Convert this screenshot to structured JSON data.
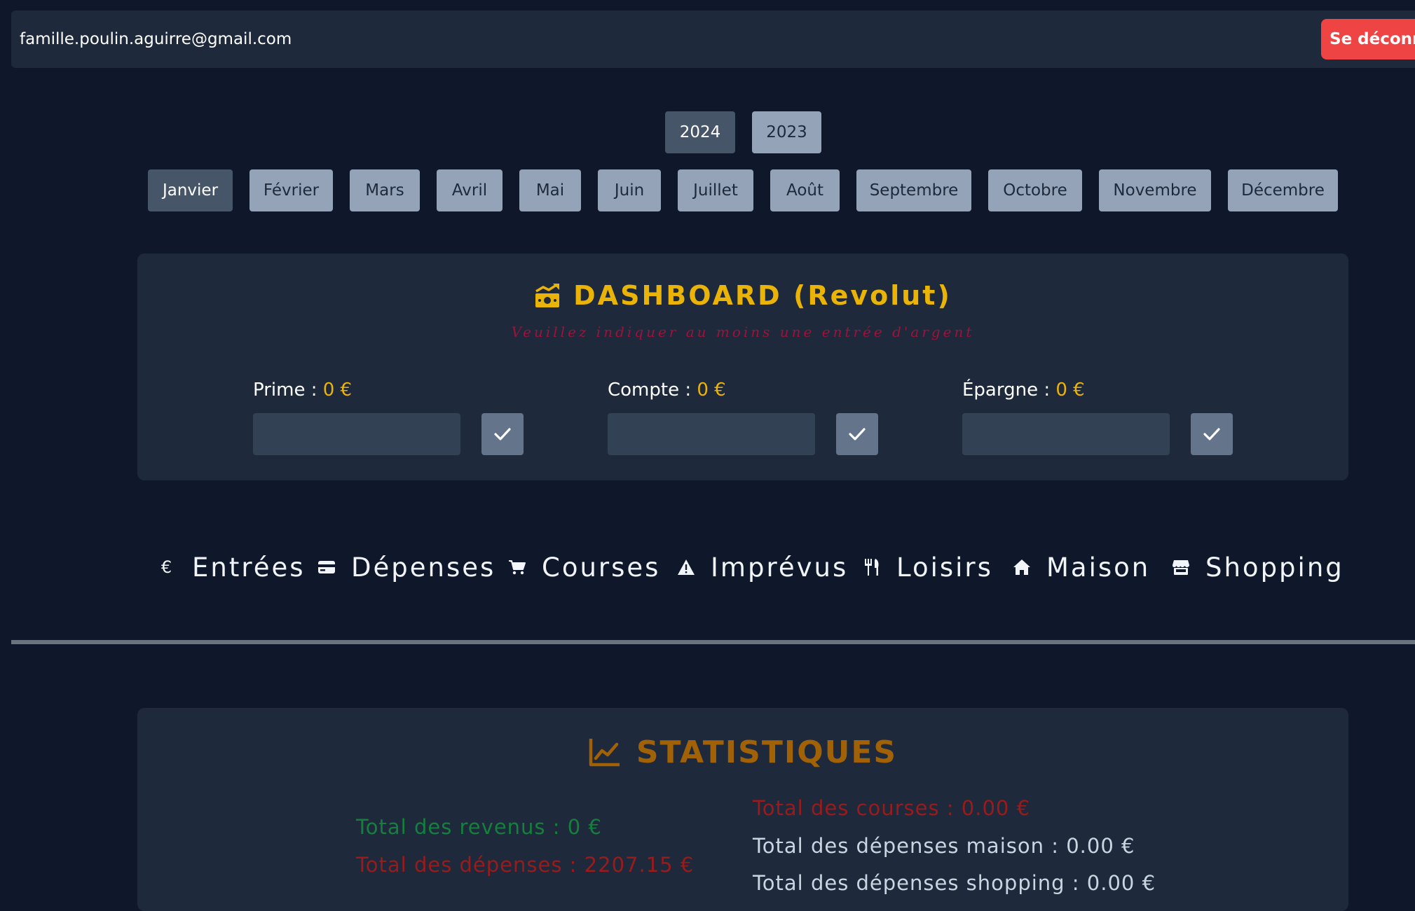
{
  "header": {
    "email": "famille.poulin.aguirre@gmail.com",
    "logout_label": "Se déconnecter"
  },
  "years": [
    {
      "label": "2024",
      "active": true
    },
    {
      "label": "2023",
      "active": false
    }
  ],
  "months": [
    {
      "label": "Janvier",
      "active": true
    },
    {
      "label": "Février"
    },
    {
      "label": "Mars"
    },
    {
      "label": "Avril"
    },
    {
      "label": "Mai"
    },
    {
      "label": "Juin"
    },
    {
      "label": "Juillet"
    },
    {
      "label": "Août"
    },
    {
      "label": "Septembre"
    },
    {
      "label": "Octobre"
    },
    {
      "label": "Novembre"
    },
    {
      "label": "Décembre"
    }
  ],
  "dashboard": {
    "icon": "money-bill-trend-icon",
    "title": "DASHBOARD (Revolut)",
    "subtitle": "Veuillez indiquer au moins une entrée d'argent",
    "fields": [
      {
        "label": "Prime :",
        "value": "0 €",
        "input_value": ""
      },
      {
        "label": "Compte :",
        "value": "0 €",
        "input_value": ""
      },
      {
        "label": "Épargne :",
        "value": "0 €",
        "input_value": ""
      }
    ]
  },
  "categories": [
    {
      "icon": "euro-icon",
      "glyph": "€",
      "label": "Entrées"
    },
    {
      "icon": "credit-card-icon",
      "glyph": "",
      "label": "Dépenses"
    },
    {
      "icon": "cart-icon",
      "glyph": "",
      "label": "Courses"
    },
    {
      "icon": "warning-icon",
      "glyph": "",
      "label": "Imprévus"
    },
    {
      "icon": "utensils-icon",
      "glyph": "",
      "label": "Loisirs"
    },
    {
      "icon": "home-icon",
      "glyph": "",
      "label": "Maison"
    },
    {
      "icon": "store-icon",
      "glyph": "",
      "label": "Shopping"
    }
  ],
  "statistics": {
    "icon": "chart-line-icon",
    "title": "STATISTIQUES",
    "left": [
      {
        "text": "Total des revenus : 0 €",
        "color": "#15803d"
      },
      {
        "text": "Total des dépenses : 2207.15 €",
        "color": "#991b1b"
      }
    ],
    "right": [
      {
        "text": "Total des courses : 0.00 €",
        "color": "#991b1b"
      },
      {
        "text": "Total des dépenses maison : 0.00 €",
        "color": "#cbd5e1"
      },
      {
        "text": "Total des dépenses shopping : 0.00 €",
        "color": "#cbd5e1"
      }
    ]
  },
  "colors": {
    "background": "#0f172a",
    "panel": "#1e293b",
    "accent": "#eab308",
    "danger": "#ef4444",
    "pill": "#94a3b8",
    "pill_active": "#475569"
  }
}
